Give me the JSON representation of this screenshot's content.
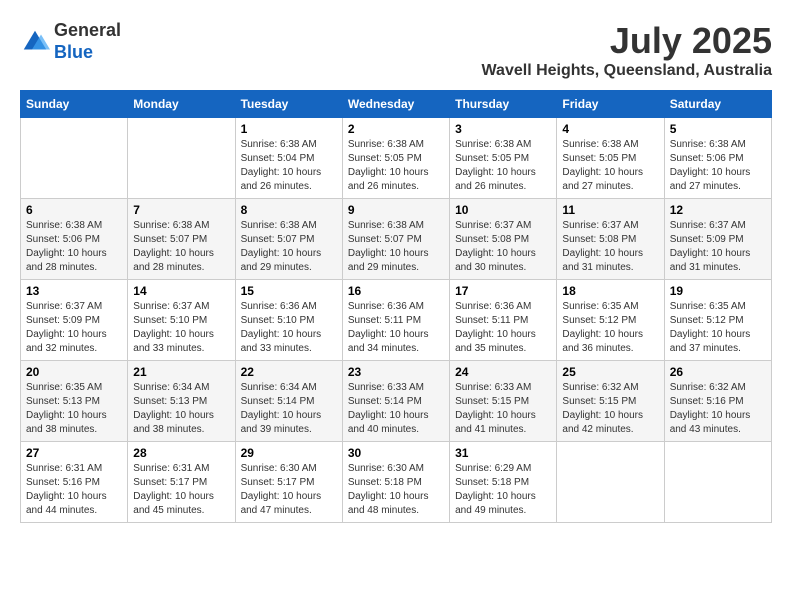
{
  "header": {
    "logo_line1": "General",
    "logo_line2": "Blue",
    "month": "July 2025",
    "location": "Wavell Heights, Queensland, Australia"
  },
  "weekdays": [
    "Sunday",
    "Monday",
    "Tuesday",
    "Wednesday",
    "Thursday",
    "Friday",
    "Saturday"
  ],
  "weeks": [
    [
      {
        "day": "",
        "sunrise": "",
        "sunset": "",
        "daylight": ""
      },
      {
        "day": "",
        "sunrise": "",
        "sunset": "",
        "daylight": ""
      },
      {
        "day": "1",
        "sunrise": "Sunrise: 6:38 AM",
        "sunset": "Sunset: 5:04 PM",
        "daylight": "Daylight: 10 hours and 26 minutes."
      },
      {
        "day": "2",
        "sunrise": "Sunrise: 6:38 AM",
        "sunset": "Sunset: 5:05 PM",
        "daylight": "Daylight: 10 hours and 26 minutes."
      },
      {
        "day": "3",
        "sunrise": "Sunrise: 6:38 AM",
        "sunset": "Sunset: 5:05 PM",
        "daylight": "Daylight: 10 hours and 26 minutes."
      },
      {
        "day": "4",
        "sunrise": "Sunrise: 6:38 AM",
        "sunset": "Sunset: 5:05 PM",
        "daylight": "Daylight: 10 hours and 27 minutes."
      },
      {
        "day": "5",
        "sunrise": "Sunrise: 6:38 AM",
        "sunset": "Sunset: 5:06 PM",
        "daylight": "Daylight: 10 hours and 27 minutes."
      }
    ],
    [
      {
        "day": "6",
        "sunrise": "Sunrise: 6:38 AM",
        "sunset": "Sunset: 5:06 PM",
        "daylight": "Daylight: 10 hours and 28 minutes."
      },
      {
        "day": "7",
        "sunrise": "Sunrise: 6:38 AM",
        "sunset": "Sunset: 5:07 PM",
        "daylight": "Daylight: 10 hours and 28 minutes."
      },
      {
        "day": "8",
        "sunrise": "Sunrise: 6:38 AM",
        "sunset": "Sunset: 5:07 PM",
        "daylight": "Daylight: 10 hours and 29 minutes."
      },
      {
        "day": "9",
        "sunrise": "Sunrise: 6:38 AM",
        "sunset": "Sunset: 5:07 PM",
        "daylight": "Daylight: 10 hours and 29 minutes."
      },
      {
        "day": "10",
        "sunrise": "Sunrise: 6:37 AM",
        "sunset": "Sunset: 5:08 PM",
        "daylight": "Daylight: 10 hours and 30 minutes."
      },
      {
        "day": "11",
        "sunrise": "Sunrise: 6:37 AM",
        "sunset": "Sunset: 5:08 PM",
        "daylight": "Daylight: 10 hours and 31 minutes."
      },
      {
        "day": "12",
        "sunrise": "Sunrise: 6:37 AM",
        "sunset": "Sunset: 5:09 PM",
        "daylight": "Daylight: 10 hours and 31 minutes."
      }
    ],
    [
      {
        "day": "13",
        "sunrise": "Sunrise: 6:37 AM",
        "sunset": "Sunset: 5:09 PM",
        "daylight": "Daylight: 10 hours and 32 minutes."
      },
      {
        "day": "14",
        "sunrise": "Sunrise: 6:37 AM",
        "sunset": "Sunset: 5:10 PM",
        "daylight": "Daylight: 10 hours and 33 minutes."
      },
      {
        "day": "15",
        "sunrise": "Sunrise: 6:36 AM",
        "sunset": "Sunset: 5:10 PM",
        "daylight": "Daylight: 10 hours and 33 minutes."
      },
      {
        "day": "16",
        "sunrise": "Sunrise: 6:36 AM",
        "sunset": "Sunset: 5:11 PM",
        "daylight": "Daylight: 10 hours and 34 minutes."
      },
      {
        "day": "17",
        "sunrise": "Sunrise: 6:36 AM",
        "sunset": "Sunset: 5:11 PM",
        "daylight": "Daylight: 10 hours and 35 minutes."
      },
      {
        "day": "18",
        "sunrise": "Sunrise: 6:35 AM",
        "sunset": "Sunset: 5:12 PM",
        "daylight": "Daylight: 10 hours and 36 minutes."
      },
      {
        "day": "19",
        "sunrise": "Sunrise: 6:35 AM",
        "sunset": "Sunset: 5:12 PM",
        "daylight": "Daylight: 10 hours and 37 minutes."
      }
    ],
    [
      {
        "day": "20",
        "sunrise": "Sunrise: 6:35 AM",
        "sunset": "Sunset: 5:13 PM",
        "daylight": "Daylight: 10 hours and 38 minutes."
      },
      {
        "day": "21",
        "sunrise": "Sunrise: 6:34 AM",
        "sunset": "Sunset: 5:13 PM",
        "daylight": "Daylight: 10 hours and 38 minutes."
      },
      {
        "day": "22",
        "sunrise": "Sunrise: 6:34 AM",
        "sunset": "Sunset: 5:14 PM",
        "daylight": "Daylight: 10 hours and 39 minutes."
      },
      {
        "day": "23",
        "sunrise": "Sunrise: 6:33 AM",
        "sunset": "Sunset: 5:14 PM",
        "daylight": "Daylight: 10 hours and 40 minutes."
      },
      {
        "day": "24",
        "sunrise": "Sunrise: 6:33 AM",
        "sunset": "Sunset: 5:15 PM",
        "daylight": "Daylight: 10 hours and 41 minutes."
      },
      {
        "day": "25",
        "sunrise": "Sunrise: 6:32 AM",
        "sunset": "Sunset: 5:15 PM",
        "daylight": "Daylight: 10 hours and 42 minutes."
      },
      {
        "day": "26",
        "sunrise": "Sunrise: 6:32 AM",
        "sunset": "Sunset: 5:16 PM",
        "daylight": "Daylight: 10 hours and 43 minutes."
      }
    ],
    [
      {
        "day": "27",
        "sunrise": "Sunrise: 6:31 AM",
        "sunset": "Sunset: 5:16 PM",
        "daylight": "Daylight: 10 hours and 44 minutes."
      },
      {
        "day": "28",
        "sunrise": "Sunrise: 6:31 AM",
        "sunset": "Sunset: 5:17 PM",
        "daylight": "Daylight: 10 hours and 45 minutes."
      },
      {
        "day": "29",
        "sunrise": "Sunrise: 6:30 AM",
        "sunset": "Sunset: 5:17 PM",
        "daylight": "Daylight: 10 hours and 47 minutes."
      },
      {
        "day": "30",
        "sunrise": "Sunrise: 6:30 AM",
        "sunset": "Sunset: 5:18 PM",
        "daylight": "Daylight: 10 hours and 48 minutes."
      },
      {
        "day": "31",
        "sunrise": "Sunrise: 6:29 AM",
        "sunset": "Sunset: 5:18 PM",
        "daylight": "Daylight: 10 hours and 49 minutes."
      },
      {
        "day": "",
        "sunrise": "",
        "sunset": "",
        "daylight": ""
      },
      {
        "day": "",
        "sunrise": "",
        "sunset": "",
        "daylight": ""
      }
    ]
  ]
}
